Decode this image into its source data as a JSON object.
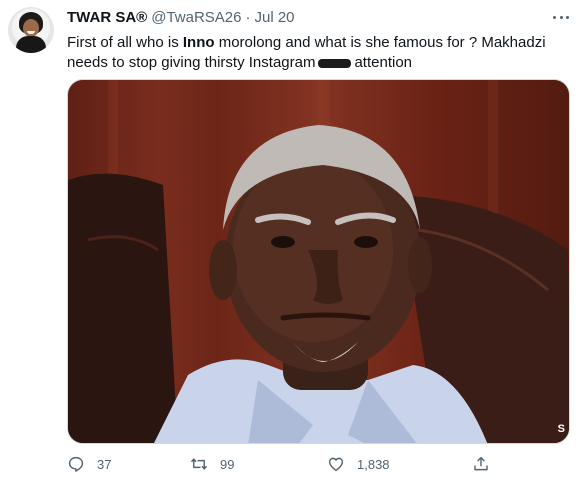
{
  "tweet": {
    "author_name": "TWAR SA®",
    "handle": "@TwaRSA26",
    "separator": "·",
    "date": "Jul 20",
    "text_part1": "First of all who is ",
    "text_bold": "Inno",
    "text_part2": " morolong and what is she famous for ? Makhadzi needs to stop giving thirsty Instagram",
    "text_part3": "attention",
    "media_watermark": "S"
  },
  "actions": {
    "reply_count": "37",
    "retweet_count": "99",
    "like_count": "1,838"
  },
  "colors": {
    "text": "#0f1419",
    "secondary": "#536471",
    "border": "#cfd9de"
  },
  "icons": [
    "avatar",
    "more-options-icon",
    "reply-icon",
    "retweet-icon",
    "like-icon",
    "share-icon"
  ]
}
